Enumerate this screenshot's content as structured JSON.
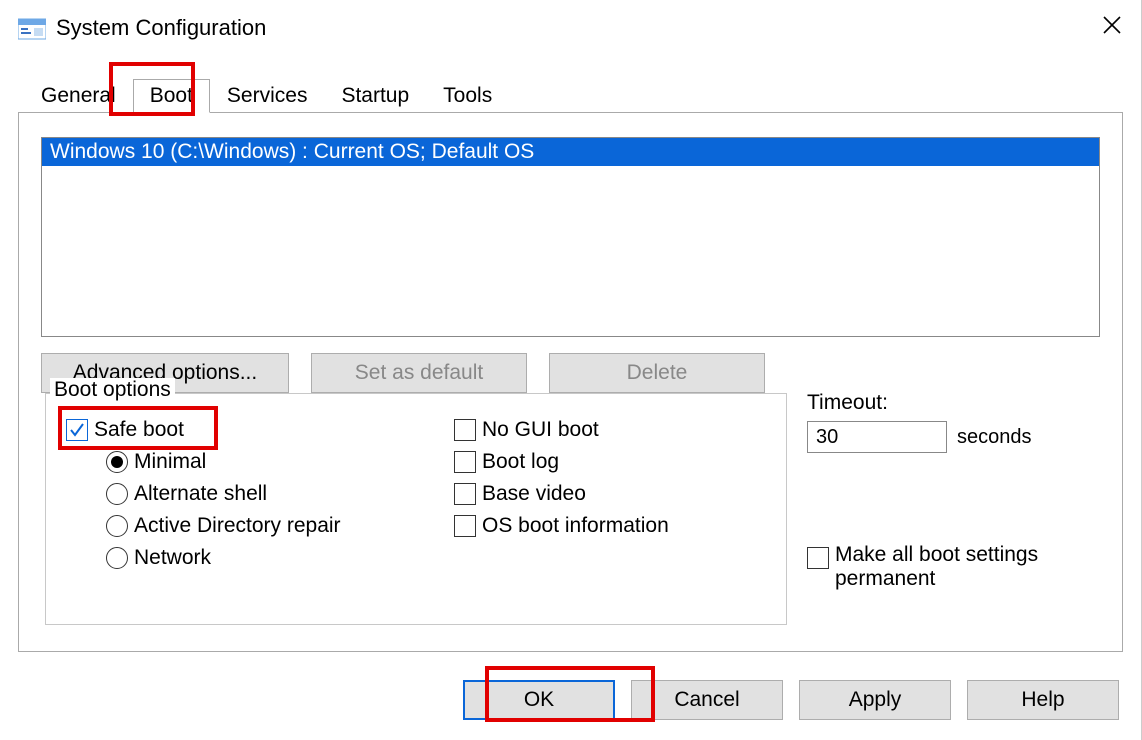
{
  "window": {
    "title": "System Configuration"
  },
  "tabs": {
    "general": "General",
    "boot": "Boot",
    "services": "Services",
    "startup": "Startup",
    "tools": "Tools",
    "active": "boot"
  },
  "os_list": {
    "selected": "Windows 10 (C:\\Windows) : Current OS; Default OS"
  },
  "buttons_row1": {
    "advanced": "Advanced options...",
    "set_default": "Set as default",
    "delete": "Delete"
  },
  "boot_options": {
    "legend": "Boot options",
    "safe_boot": {
      "label": "Safe boot",
      "checked": true
    },
    "radios": {
      "minimal": "Minimal",
      "alt_shell": "Alternate shell",
      "ad_repair": "Active Directory repair",
      "network": "Network",
      "selected": "minimal"
    },
    "right": {
      "no_gui": {
        "label": "No GUI boot",
        "checked": false
      },
      "boot_log": {
        "label": "Boot log",
        "checked": false
      },
      "base_video": {
        "label": "Base video",
        "checked": false
      },
      "os_boot_info": {
        "label": "OS boot information",
        "checked": false
      }
    }
  },
  "timeout": {
    "label": "Timeout:",
    "value": "30",
    "suffix": "seconds"
  },
  "make_permanent": {
    "label": "Make all boot settings permanent",
    "checked": false
  },
  "bottom": {
    "ok": "OK",
    "cancel": "Cancel",
    "apply": "Apply",
    "help": "Help"
  }
}
